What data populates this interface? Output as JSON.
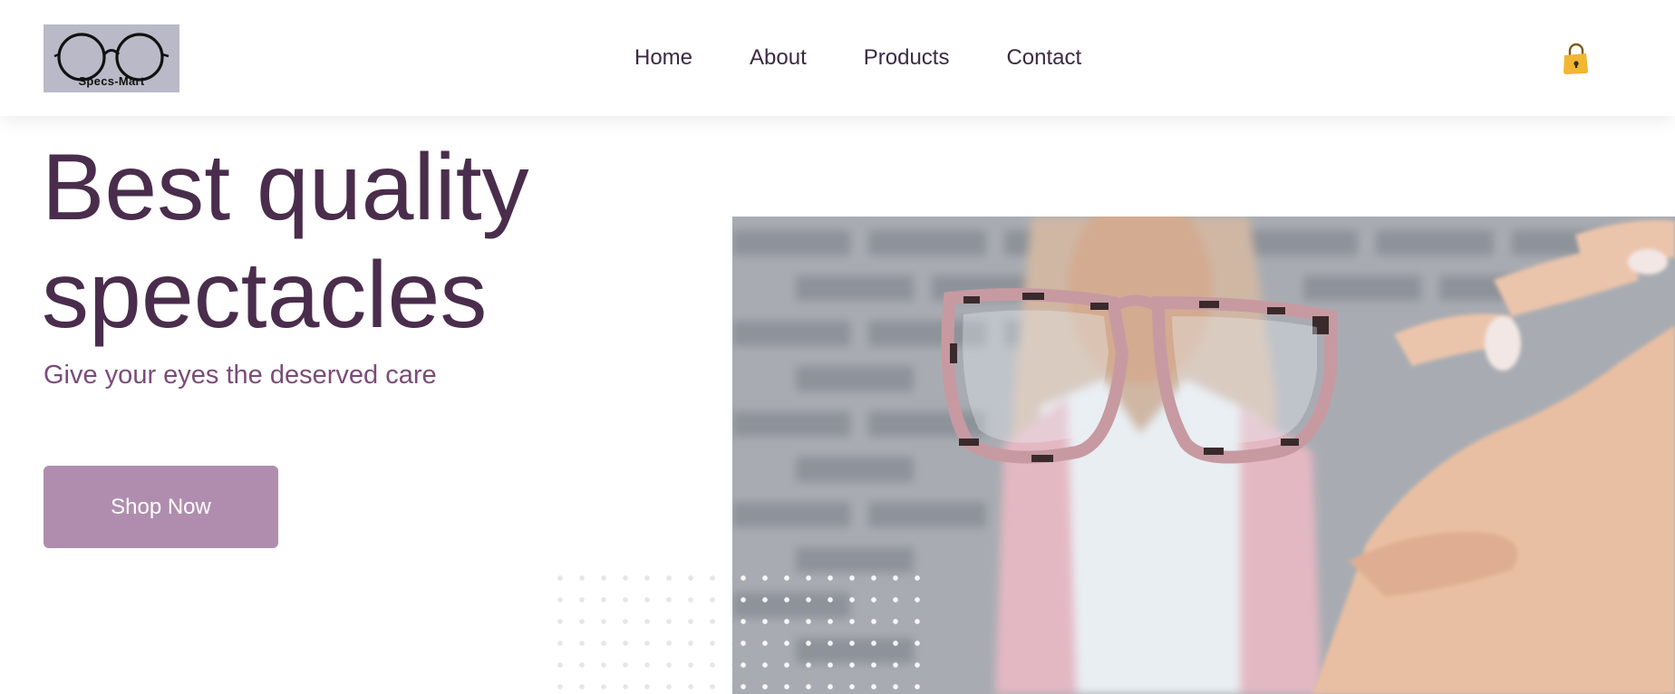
{
  "brand": {
    "logo_text": "Specs-Mart"
  },
  "nav": {
    "home": "Home",
    "about": "About",
    "products": "Products",
    "contact": "Contact"
  },
  "hero": {
    "title": "Best quality spectacles",
    "subtitle": "Give your eyes the deserved care",
    "cta_label": "Shop Now"
  },
  "icons": {
    "logo": "glasses-icon",
    "cart": "shopping-bag-icon"
  },
  "colors": {
    "brand_text": "#4a2d4c",
    "subtitle": "#7a4c79",
    "cta_background": "#b08daf",
    "cart_icon": "#f2b631",
    "logo_background": "#b9b9c7"
  }
}
